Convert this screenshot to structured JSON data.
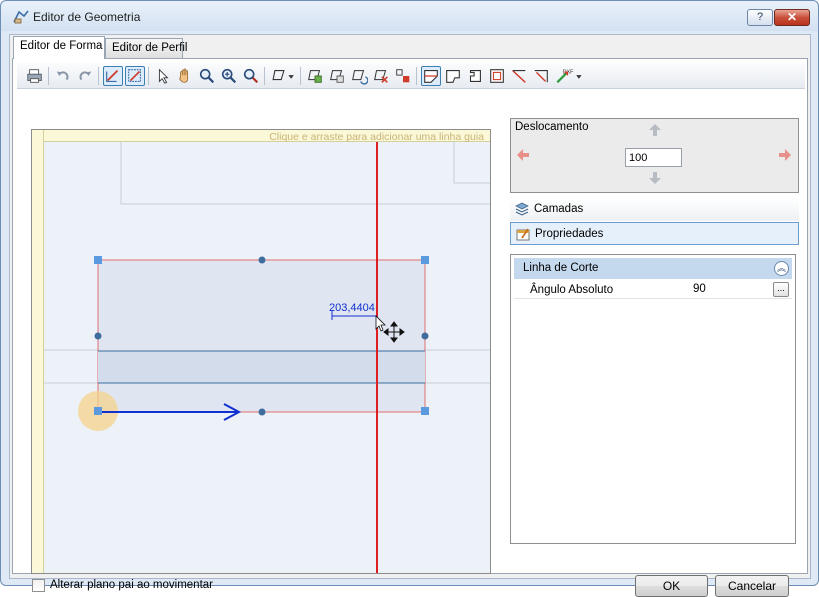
{
  "window": {
    "title": "Editor de Geometria",
    "help_label": "?",
    "close_label": "✕"
  },
  "tabs": [
    {
      "label": "Editor de Forma",
      "active": true
    },
    {
      "label": "Editor de Perfil",
      "active": false
    }
  ],
  "canvas": {
    "guide_hint": "Clique e arraste para adicionar uma linha guia",
    "measurement": "203,4404"
  },
  "deslocamento": {
    "label": "Deslocamento",
    "value": "100"
  },
  "panels": {
    "camadas": "Camadas",
    "propriedades": "Propriedades"
  },
  "properties": {
    "group": "Linha de Corte",
    "rows": [
      {
        "name": "Ângulo Absoluto",
        "value": "90",
        "button": "..."
      }
    ]
  },
  "footer": {
    "checkbox_label": "Alterar plano pai ao movimentar",
    "checkbox_checked": false,
    "ok_label": "OK",
    "cancel_label": "Cancelar"
  },
  "colors": {
    "cut_line": "#e02020",
    "selection": "#e07070",
    "handle": "#5c9ae0",
    "arrow": "#1030d0",
    "accent_panel": "#c4d8ee"
  }
}
